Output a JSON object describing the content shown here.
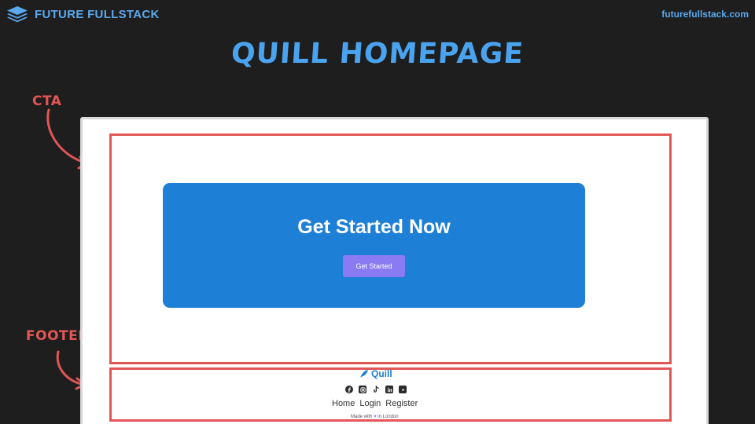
{
  "brand": {
    "name": "FUTURE FULLSTACK",
    "url": "futurefullstack.com",
    "icon": "stack-layers-icon"
  },
  "slide_title": "QUILL HOMEPAGE",
  "annotations": {
    "cta": "CTA",
    "footer": "FOOTER"
  },
  "cta": {
    "heading": "Get Started Now",
    "button_label": "Get Started"
  },
  "footer": {
    "logo_text": "Quill",
    "logo_icon": "feather-icon",
    "social_icons": [
      "facebook-icon",
      "instagram-icon",
      "tiktok-icon",
      "linkedin-icon",
      "youtube-icon"
    ],
    "nav": [
      {
        "label": "Home"
      },
      {
        "label": "Login"
      },
      {
        "label": "Register"
      }
    ],
    "made_with_prefix": "Made with",
    "made_with_suffix": "in London"
  },
  "colors": {
    "background": "#1e1e1e",
    "accent": "#5aa9ef",
    "annotation": "#e25656",
    "cta_card": "#1e7fd6",
    "cta_button": "#8b7bf2"
  }
}
